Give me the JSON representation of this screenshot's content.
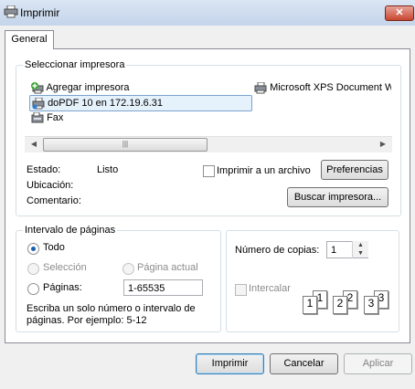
{
  "window": {
    "title": "Imprimir",
    "close_symbol": "✕"
  },
  "tabs": [
    {
      "label": "General"
    }
  ],
  "printer_section": {
    "label": "Seleccionar impresora",
    "printers": [
      {
        "name": "Agregar impresora",
        "icon": "add-printer-icon"
      },
      {
        "name": "doPDF 10 en 172.19.6.31",
        "icon": "network-printer-icon",
        "selected": true
      },
      {
        "name": "Fax",
        "icon": "fax-icon"
      },
      {
        "name": "Microsoft XPS Document Writer",
        "icon": "printer-icon"
      }
    ],
    "status_label": "Estado:",
    "status_value": "Listo",
    "location_label": "Ubicación:",
    "location_value": "",
    "comment_label": "Comentario:",
    "comment_value": "",
    "print_to_file_label": "Imprimir a un archivo",
    "preferences_button": "Preferencias",
    "find_printer_button": "Buscar impresora..."
  },
  "page_range": {
    "label": "Intervalo de páginas",
    "all_label": "Todo",
    "selection_label": "Selección",
    "current_page_label": "Página actual",
    "pages_label": "Páginas:",
    "pages_value": "1-65535",
    "hint": "Escriba un solo número o intervalo de páginas. Por ejemplo: 5-12"
  },
  "copies": {
    "label": "Número de copias:",
    "value": "1",
    "collate_label": "Intercalar",
    "collate_pages": [
      "1",
      "1",
      "2",
      "2",
      "3",
      "3"
    ]
  },
  "buttons": {
    "print": "Imprimir",
    "cancel": "Cancelar",
    "apply": "Aplicar"
  },
  "colors": {
    "titlebar": "#c4d4ea",
    "selected_item": "#e5f1fb",
    "default_button_border": "#3c7fb1"
  }
}
